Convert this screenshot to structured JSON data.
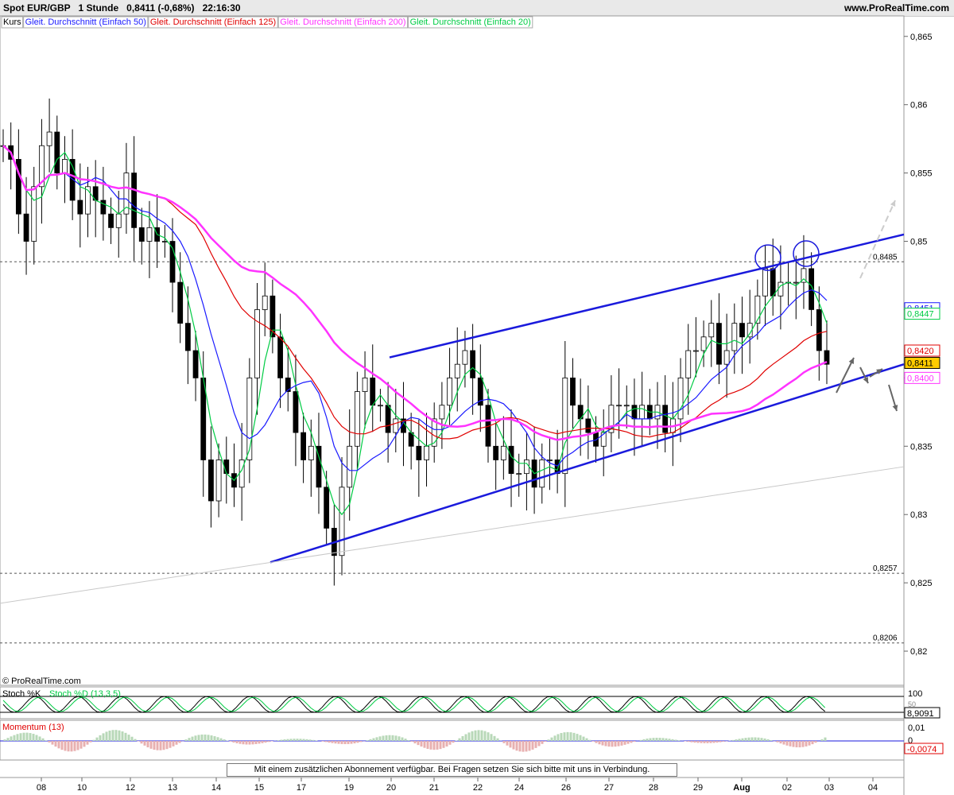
{
  "header": {
    "instrument": "Spot EUR/GBP",
    "timeframe": "1 Stunde",
    "last": "0,8411 (-0,68%)",
    "time": "22:16:30",
    "site": "www.ProRealTime.com"
  },
  "legend": [
    {
      "label": "Kurs",
      "color": "#000000"
    },
    {
      "label": "Gleit. Durchschnitt (Einfach 50)",
      "color": "#1a1aff"
    },
    {
      "label": "Gleit. Durchschnitt (Einfach 125)",
      "color": "#e00000"
    },
    {
      "label": "Gleit. Durchschnitt (Einfach 200)",
      "color": "#ff33ff"
    },
    {
      "label": "Gleit. Durchschnitt (Einfach 20)",
      "color": "#00cc44"
    }
  ],
  "copyright": "© ProRealTime.com",
  "subscription_notice": "Mit einem zusätzlichen Abonnement verfügbar. Bei Fragen setzen Sie sich bitte mit uns in Verbindung.",
  "chart_data": {
    "type": "candlestick",
    "price_ticks": [
      "0,865",
      "0,86",
      "0,855",
      "0,85",
      "0,845",
      "0,84",
      "0,835",
      "0,83",
      "0,825",
      "0,82"
    ],
    "price_tick_values": [
      0.865,
      0.86,
      0.855,
      0.85,
      0.845,
      0.84,
      0.835,
      0.83,
      0.825,
      0.82
    ],
    "ylim": [
      0.8175,
      0.8665
    ],
    "x_labels": [
      "08",
      "10",
      "12",
      "13",
      "14",
      "15",
      "17",
      "19",
      "20",
      "21",
      "22",
      "24",
      "26",
      "27",
      "28",
      "29",
      "Aug",
      "02",
      "03",
      "04"
    ],
    "horizontal_levels": [
      {
        "value": 0.8485,
        "label": "0,8485"
      },
      {
        "value": 0.8257,
        "label": "0,8257"
      },
      {
        "value": 0.8206,
        "label": "0,8206"
      }
    ],
    "price_tags": [
      {
        "label": "0,8451",
        "value": 0.8451,
        "color": "#1a1aff"
      },
      {
        "label": "0,8447",
        "value": 0.8447,
        "color": "#00cc44"
      },
      {
        "label": "0,8420",
        "value": 0.842,
        "color": "#e00000"
      },
      {
        "label": "0,8411",
        "value": 0.8411,
        "color": "#000000"
      },
      {
        "label": "0,8400",
        "value": 0.84,
        "color": "#ff33ff"
      }
    ],
    "close_series": [
      0.857,
      0.856,
      0.852,
      0.85,
      0.854,
      0.857,
      0.858,
      0.855,
      0.856,
      0.853,
      0.852,
      0.854,
      0.853,
      0.852,
      0.851,
      0.852,
      0.855,
      0.851,
      0.85,
      0.851,
      0.85,
      0.85,
      0.847,
      0.844,
      0.842,
      0.84,
      0.834,
      0.831,
      0.834,
      0.833,
      0.832,
      0.834,
      0.84,
      0.845,
      0.846,
      0.843,
      0.84,
      0.839,
      0.836,
      0.834,
      0.835,
      0.832,
      0.829,
      0.827,
      0.832,
      0.835,
      0.839,
      0.84,
      0.838,
      0.838,
      0.836,
      0.837,
      0.836,
      0.835,
      0.834,
      0.835,
      0.837,
      0.838,
      0.84,
      0.841,
      0.842,
      0.84,
      0.838,
      0.835,
      0.834,
      0.835,
      0.833,
      0.833,
      0.834,
      0.832,
      0.834,
      0.834,
      0.833,
      0.84,
      0.838,
      0.837,
      0.836,
      0.835,
      0.836,
      0.838,
      0.838,
      0.838,
      0.837,
      0.838,
      0.837,
      0.838,
      0.836,
      0.837,
      0.84,
      0.842,
      0.842,
      0.843,
      0.844,
      0.841,
      0.842,
      0.844,
      0.843,
      0.844,
      0.846,
      0.848,
      0.846,
      0.847,
      0.847,
      0.847,
      0.848,
      0.845,
      0.842,
      0.841
    ],
    "annotations": {
      "trend_channel": "rising wedge (blue lines)",
      "circles": 2,
      "arrows": 4
    }
  },
  "indicators": {
    "stoch": {
      "label_k": "Stoch %K",
      "label_d": "Stoch %D (13,3,5)",
      "ticks": [
        "100",
        "50"
      ],
      "value": "8,9091"
    },
    "momentum": {
      "label": "Momentum (13)",
      "ticks": [
        "0,01",
        "0"
      ],
      "value": "-0,0074"
    }
  }
}
